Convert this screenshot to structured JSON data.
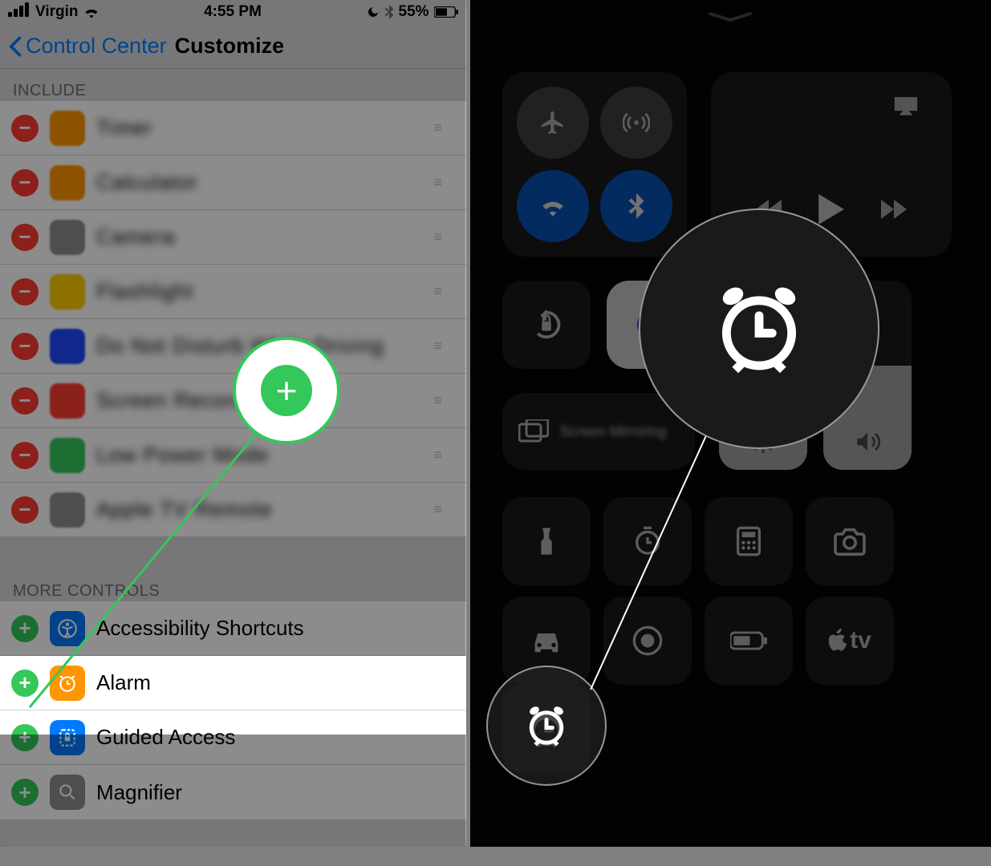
{
  "status": {
    "carrier": "Virgin",
    "time": "4:55 PM",
    "battery_text": "55%"
  },
  "nav": {
    "back_label": "Control Center",
    "title": "Customize"
  },
  "sections": {
    "include_label": "INCLUDE",
    "more_label": "MORE CONTROLS"
  },
  "include_rows": [
    {
      "label": "Timer",
      "icon_color": "ic-orange"
    },
    {
      "label": "Calculator",
      "icon_color": "ic-orange"
    },
    {
      "label": "Camera",
      "icon_color": "ic-gray"
    },
    {
      "label": "Flashlight",
      "icon_color": "ic-yellow"
    },
    {
      "label": "Do Not Disturb While Driving",
      "icon_color": "ic-dblue"
    },
    {
      "label": "Screen Recording",
      "icon_color": "ic-red"
    },
    {
      "label": "Low Power Mode",
      "icon_color": "ic-green"
    },
    {
      "label": "Apple TV Remote",
      "icon_color": "ic-gray"
    }
  ],
  "more_rows": [
    {
      "label": "Accessibility Shortcuts",
      "icon_color": "ic-blue"
    },
    {
      "label": "Alarm",
      "icon_color": "ic-orange"
    },
    {
      "label": "Guided Access",
      "icon_color": "ic-blue"
    },
    {
      "label": "Magnifier",
      "icon_color": "ic-gray"
    }
  ],
  "right_panel": {
    "apple_tv_label": "tv"
  }
}
